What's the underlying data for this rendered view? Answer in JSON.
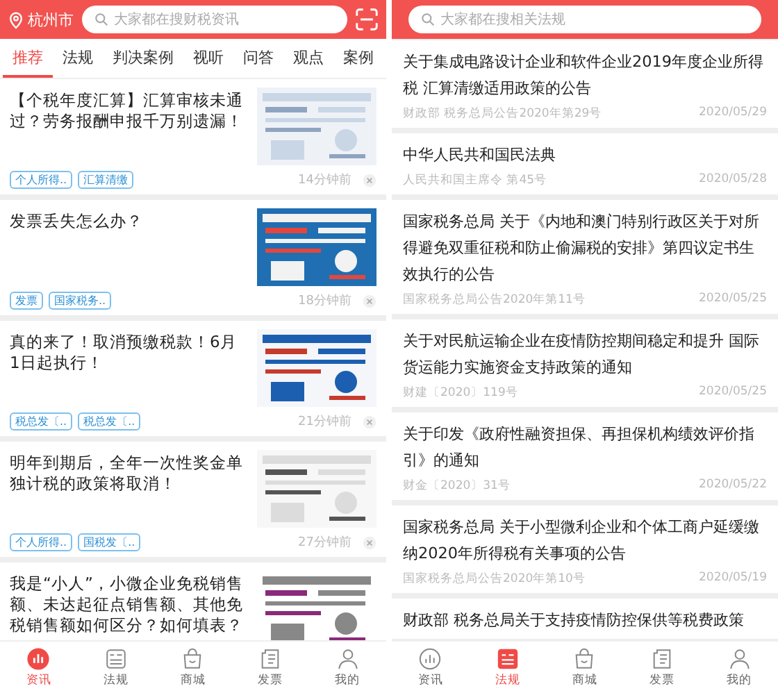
{
  "left_phone": {
    "location": "杭州市",
    "search_placeholder": "大家都在搜财税资讯",
    "tabs": [
      {
        "label": "推荐",
        "selected": true
      },
      {
        "label": "法规",
        "selected": false
      },
      {
        "label": "判决案例",
        "selected": false
      },
      {
        "label": "视听",
        "selected": false
      },
      {
        "label": "问答",
        "selected": false
      },
      {
        "label": "观点",
        "selected": false
      },
      {
        "label": "案例",
        "selected": false
      }
    ],
    "articles": [
      {
        "title": "【个税年度汇算】汇算审核未通过？劳务报酬申报千万别遗漏！",
        "tags": [
          "个人所得..",
          "汇算清缴"
        ],
        "time": "14分钟前"
      },
      {
        "title": "发票丢失怎么办？",
        "tags": [
          "发票",
          "国家税务.."
        ],
        "time": "18分钟前"
      },
      {
        "title": "真的来了！取消预缴税款！6月1日起执行！",
        "tags": [
          "税总发〔..",
          "税总发〔.."
        ],
        "time": "21分钟前"
      },
      {
        "title": "明年到期后，全年一次性奖金单独计税的政策将取消！",
        "tags": [
          "个人所得..",
          "国税发〔.."
        ],
        "time": "27分钟前"
      },
      {
        "title": "我是“小人”，小微企业免税销售额、未达起征点销售额、其他免税销售额如何区分？如何填表？"
      }
    ],
    "nav": [
      {
        "label": "资讯",
        "kind": "chart",
        "selected": true
      },
      {
        "label": "法规",
        "kind": "list",
        "selected": false
      },
      {
        "label": "商城",
        "kind": "bag",
        "selected": false
      },
      {
        "label": "发票",
        "kind": "doc",
        "selected": false
      },
      {
        "label": "我的",
        "kind": "person",
        "selected": false
      }
    ]
  },
  "right_phone": {
    "search_placeholder": "大家都在搜相关法规",
    "items": [
      {
        "title": "关于集成电路设计企业和软件企业2019年度企业所得税 汇算清缴适用政策的公告",
        "source": "财政部 税务总局公告2020年第29号",
        "date": "2020/05/29"
      },
      {
        "title": "中华人民共和国民法典",
        "source": "人民共和国主席令 第45号",
        "date": "2020/05/28"
      },
      {
        "title": "国家税务总局  关于《内地和澳门特别行政区关于对所得避免双重征税和防止偷漏税的安排》第四议定书生效执行的公告",
        "source": "国家税务总局公告2020年第11号",
        "date": "2020/05/25"
      },
      {
        "title": "关于对民航运输企业在疫情防控期间稳定和提升 国际货运能力实施资金支持政策的通知",
        "source": "财建〔2020〕119号",
        "date": "2020/05/25"
      },
      {
        "title": "关于印发《政府性融资担保、再担保机构绩效评价指引》的通知",
        "source": "财金〔2020〕31号",
        "date": "2020/05/22"
      },
      {
        "title": "国家税务总局  关于小型微利企业和个体工商户延缓缴纳2020年所得税有关事项的公告",
        "source": "国家税务总局公告2020年第10号",
        "date": "2020/05/19"
      },
      {
        "title": "财政部  税务总局关于支持疫情防控保供等税费政策"
      }
    ],
    "nav": [
      {
        "label": "资讯",
        "kind": "chart",
        "selected": false
      },
      {
        "label": "法规",
        "kind": "list",
        "selected": true
      },
      {
        "label": "商城",
        "kind": "bag",
        "selected": false
      },
      {
        "label": "发票",
        "kind": "doc",
        "selected": false
      },
      {
        "label": "我的",
        "kind": "person",
        "selected": false
      }
    ]
  }
}
